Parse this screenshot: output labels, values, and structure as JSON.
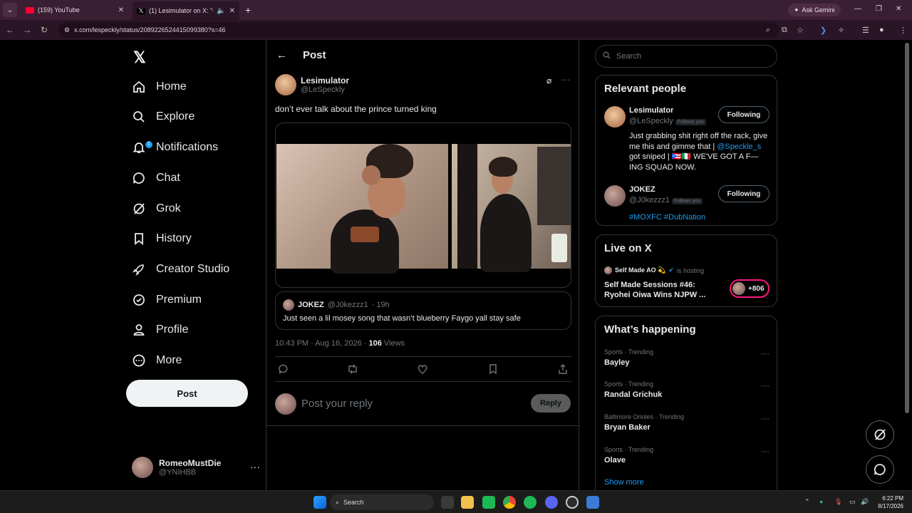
{
  "browser": {
    "tabs": [
      {
        "title": "(159) YouTube",
        "active": false
      },
      {
        "title": "(1) Lesimulator on X: \"don't",
        "active": true
      }
    ],
    "ask_gemini": "Ask Gemini",
    "url": "x.com/lespeckly/status/2089226524415099380?s=46"
  },
  "nav": {
    "logo": "𝕏",
    "items": [
      {
        "label": "Home",
        "icon": "home-icon"
      },
      {
        "label": "Explore",
        "icon": "search-icon"
      },
      {
        "label": "Notifications",
        "icon": "bell-icon"
      },
      {
        "label": "Chat",
        "icon": "chat-icon"
      },
      {
        "label": "Grok",
        "icon": "grok-icon"
      },
      {
        "label": "History",
        "icon": "bookmark-icon"
      },
      {
        "label": "Creator Studio",
        "icon": "rocket-icon"
      },
      {
        "label": "Premium",
        "icon": "verified-icon"
      },
      {
        "label": "Profile",
        "icon": "person-icon"
      },
      {
        "label": "More",
        "icon": "more-circle-icon"
      }
    ],
    "notif_badge": "1",
    "post_label": "Post",
    "account": {
      "name": "RomeoMustDie",
      "handle": "@YNIHBB"
    }
  },
  "main": {
    "title": "Post",
    "author": {
      "name": "Lesimulator",
      "handle": "@LeSpeckly"
    },
    "text": "don’t ever talk about the prince turned king",
    "quote": {
      "name": "JOKEZ",
      "handle": "@J0kezzz1",
      "time": "· 19h",
      "text": "Just seen a lil mosey song that wasn’t blueberry Faygo yall stay safe"
    },
    "meta": {
      "datetime": "10:43 PM · Aug 16, 2026 ·",
      "views_count": "106",
      "views_label": "Views"
    },
    "reply_placeholder": "Post your reply",
    "reply_label": "Reply"
  },
  "right": {
    "search_placeholder": "Search",
    "relevant": {
      "title": "Relevant people",
      "people": [
        {
          "name": "Lesimulator",
          "handle": "@LeSpeckly",
          "follows_you": "Follows you",
          "button": "Following",
          "bio_1": "Just grabbing shit right off the rack, give me this and gimme that |",
          "bio_link": "@Speckle_s",
          "bio_2": "got sniped | 🇵🇷🇮🇹 WE'VE GOT A F—ING SQUAD NOW."
        },
        {
          "name": "JOKEZ",
          "handle": "@J0kezzz1",
          "follows_you": "Follows you",
          "button": "Following",
          "bio": "#MOXFC #DubNation"
        }
      ]
    },
    "live": {
      "title": "Live on X",
      "host": "Self Made AO 💫",
      "status": "is hosting",
      "session": "Self Made Sessions #46: Ryohei Oiwa Wins NJPW ...",
      "listeners": "+806"
    },
    "happening": {
      "title": "What’s happening",
      "trends": [
        {
          "category": "Sports · Trending",
          "name": "Bayley"
        },
        {
          "category": "Sports · Trending",
          "name": "Randal Grichuk"
        },
        {
          "category": "Baltimore Orioles · Trending",
          "name": "Bryan Baker"
        },
        {
          "category": "Sports · Trending",
          "name": "Olave"
        }
      ],
      "show_more": "Show more"
    }
  },
  "taskbar": {
    "search": "Search",
    "time": "6:22 PM",
    "date": "8/17/2026"
  }
}
